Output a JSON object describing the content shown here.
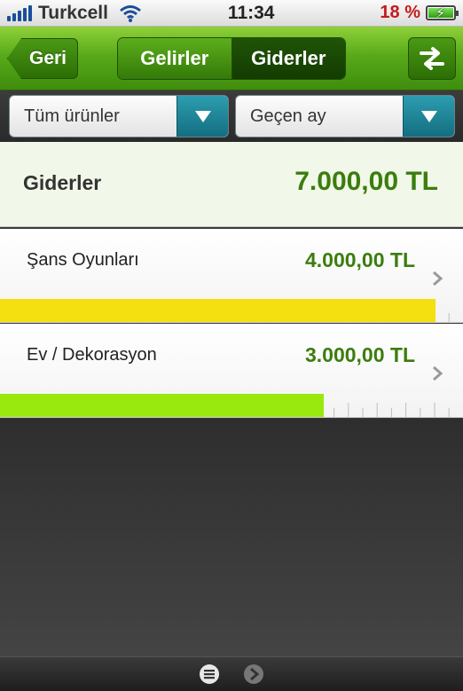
{
  "status_bar": {
    "carrier": "Turkcell",
    "time": "11:34",
    "battery_percent": "18 %"
  },
  "nav": {
    "back_label": "Geri",
    "segments": [
      "Gelirler",
      "Giderler"
    ],
    "selected_segment": "Giderler",
    "swap_icon": "swap-arrows-icon"
  },
  "filters": {
    "product_filter": "Tüm ürünler",
    "period_filter": "Geçen ay"
  },
  "summary": {
    "label": "Giderler",
    "amount": "7.000,00 TL"
  },
  "items": [
    {
      "name": "Şans Oyunları",
      "amount": "4.000,00 TL",
      "share": 0.94,
      "bar_color": "#f4e011"
    },
    {
      "name": "Ev / Dekorasyon",
      "amount": "3.000,00 TL",
      "share": 0.7,
      "bar_color": "#99e80e"
    }
  ],
  "colors": {
    "accent_green": "#3b7d0e",
    "nav_green": "#59aa1a",
    "dropdown_teal": "#1a8496"
  },
  "bottom_bar": {
    "icons": [
      "menu-icon",
      "next-icon"
    ]
  }
}
